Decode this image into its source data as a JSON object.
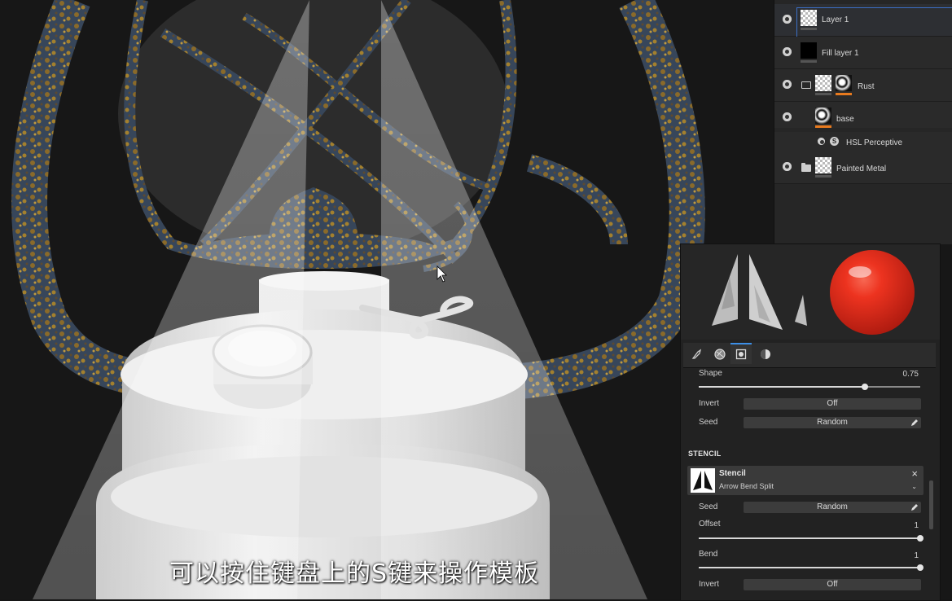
{
  "layers": [
    {
      "name": "Layer 1",
      "thumb": "checker",
      "selected": true
    },
    {
      "name": "Fill layer 1",
      "thumb": "black"
    },
    {
      "name": "Rust",
      "thumb": "checker+mask",
      "folder": true
    },
    {
      "name": "base",
      "thumb": "mask"
    },
    {
      "name": "HSL Perceptive",
      "effect": true
    },
    {
      "name": "Painted Metal",
      "thumb": "checker",
      "folder": true
    }
  ],
  "properties": {
    "shape_label": "Shape",
    "shape_value": "0.75",
    "shape_level": 0.75,
    "invert_label": "Invert",
    "invert_value": "Off",
    "seed_label": "Seed",
    "seed_value": "Random",
    "stencil_section": "STENCIL",
    "stencil_title": "Stencil",
    "stencil_name": "Arrow Bend Split",
    "stencil_seed_label": "Seed",
    "stencil_seed_value": "Random",
    "offset_label": "Offset",
    "offset_value": "1",
    "offset_level": 1,
    "bend_label": "Bend",
    "bend_value": "1",
    "bend_level": 1,
    "stencil_invert_label": "Invert",
    "stencil_invert_value": "Off"
  },
  "tabs": [
    "brush-icon",
    "alpha-icon",
    "stencil-icon",
    "material-icon"
  ],
  "colors": {
    "accent": "#3c8ee6",
    "orange_marker": "#e87a1e",
    "material_sphere": "#e8281c"
  },
  "subtitle": "可以按住键盘上的S键来操作模板"
}
